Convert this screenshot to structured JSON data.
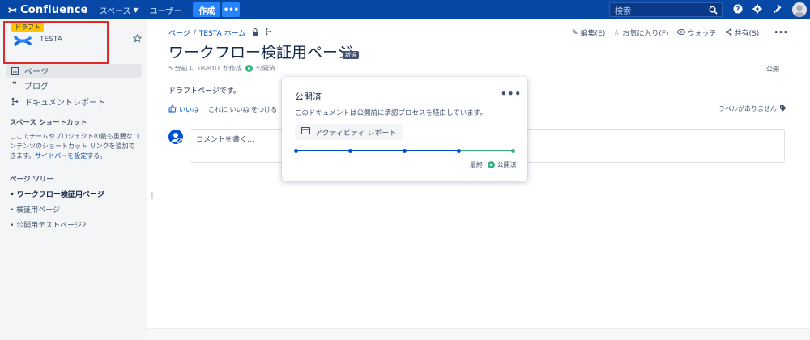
{
  "topnav": {
    "brand": "Confluence",
    "spaces": "スペース",
    "users": "ユーザー",
    "create": "作成",
    "more": "•••",
    "search_placeholder": "検索"
  },
  "sidebar": {
    "draft_badge": "ドラフト",
    "space_name": "TESTA",
    "links": [
      {
        "label": "ページ",
        "icon": "page-icon"
      },
      {
        "label": "ブログ",
        "icon": "quote-icon"
      },
      {
        "label": "ドキュメントレポート",
        "icon": "report-icon"
      }
    ],
    "shortcuts_heading": "スペース ショートカット",
    "shortcuts_text_1": "ここでチームやプロジェクトの最も重要なコンテンツのショートカット リンクを追加できます。",
    "shortcuts_link": "サイドバーを設定",
    "shortcuts_text_2": "する。",
    "tree_heading": "ページ ツリー",
    "tree": [
      "ワークフロー検証用ページ",
      "検証用ページ",
      "公開用テストページ2"
    ]
  },
  "page": {
    "breadcrumb_pages": "ページ",
    "breadcrumb_sep": "/",
    "breadcrumb_home": "TESTA ホーム",
    "actions": {
      "edit": "編集(E)",
      "favorite": "お気に入り(F)",
      "watch": "ウォッチ",
      "share": "共有(S)",
      "more": "•••"
    },
    "title": "ワークフロー検証用ページ",
    "new_badge": "新規",
    "byline": "5 分前 に user01 が作成",
    "status": "公開済",
    "publish_right": "公開",
    "body": "ドラフトページです。",
    "like": "いいね",
    "like_prompt": "これに いいね をつける",
    "no_labels": "ラベルがありません",
    "comment_placeholder": "コメントを書く..."
  },
  "popover": {
    "title": "公開済",
    "more": "•••",
    "description": "このドキュメントは公開前に承認プロセスを経由しています。",
    "activity_button": "アクティビティ レポート",
    "final_label": "最終:",
    "final_status": "公開済"
  },
  "colors": {
    "nav": "#0747a6",
    "accent": "#2684ff",
    "status_green": "#36b37e",
    "highlight_border": "#e5282c",
    "draft_badge": "#ffc400"
  }
}
